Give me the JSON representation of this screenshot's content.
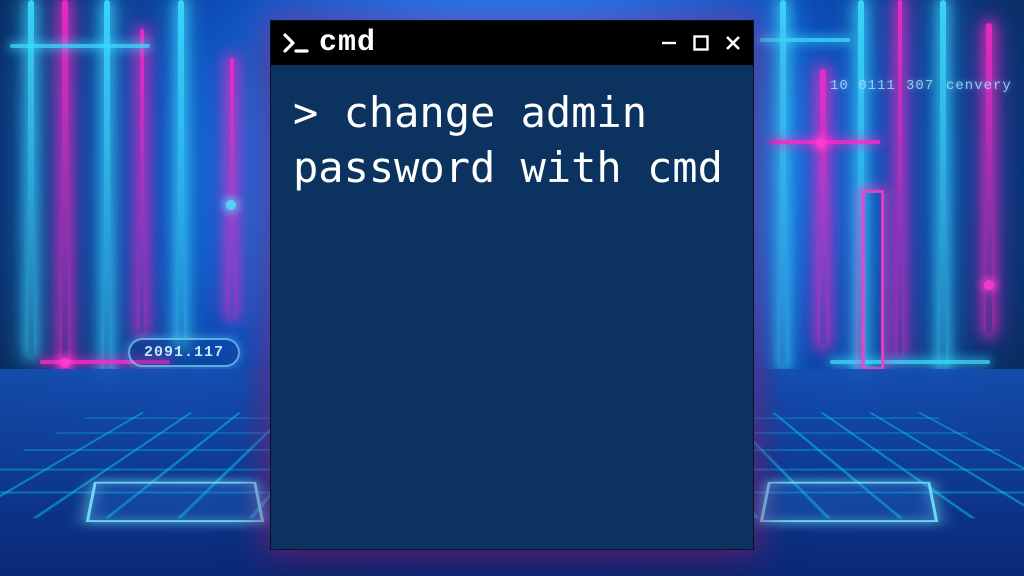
{
  "window": {
    "title": "cmd",
    "prompt_glyph": ">_",
    "controls": {
      "minimize": "minimize",
      "maximize": "maximize",
      "close": "close"
    }
  },
  "terminal": {
    "command_line": "> change admin password with cmd"
  },
  "background": {
    "pill_left": "2091.117",
    "pill_right_a": "10 0111",
    "pill_right_b": "307",
    "pill_right_c": "cenvery"
  }
}
